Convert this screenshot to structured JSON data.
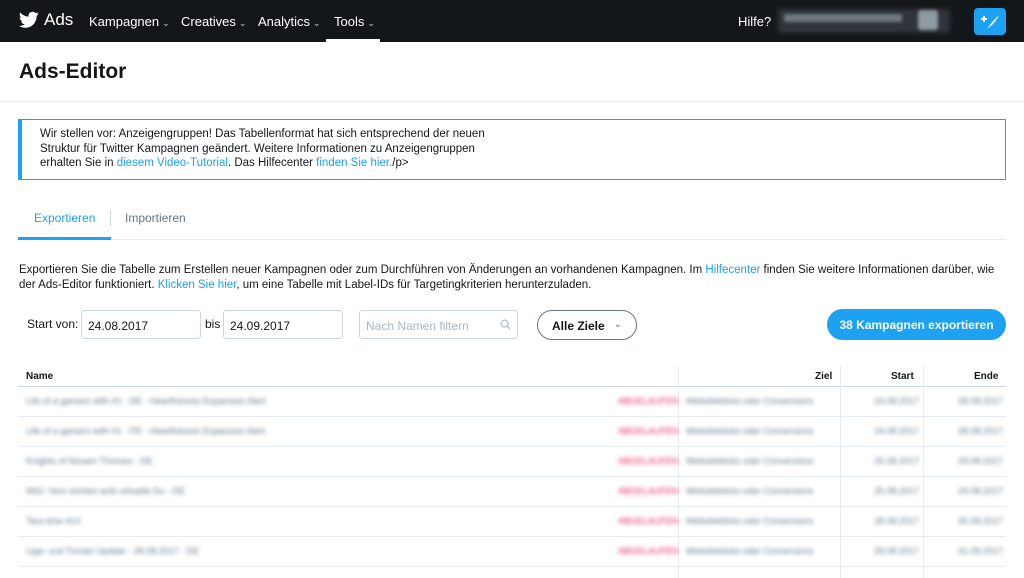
{
  "nav": {
    "brand": "Ads",
    "items": [
      "Kampagnen",
      "Creatives",
      "Analytics",
      "Tools"
    ],
    "help": "Hilfe?",
    "account": "UPC eSport Weeke"
  },
  "page_title": "Ads-Editor",
  "notice": {
    "line1": "Wir stellen vor: Anzeigengruppen! Das Tabellenformat hat sich entsprechend der neuen",
    "line2": "Struktur für Twitter Kampagnen geändert. Weitere Informationen zu Anzeigengruppen",
    "line3_pre": "erhalten Sie in ",
    "link1": "diesem Video-Tutorial",
    "line3_mid": ". Das Hilfecenter ",
    "link2": "finden Sie hier.",
    "line3_post": "/p>"
  },
  "tabs": {
    "export": "Exportieren",
    "import": "Importieren"
  },
  "intro": {
    "t1": "Exportieren Sie die Tabelle zum Erstellen neuer Kampagnen oder zum Durchführen von Änderungen an vorhandenen Kampagnen. Im ",
    "link1": "Hilfecenter",
    "t2": " finden Sie weitere Informationen darüber, wie der Ads-Editor funktioniert. ",
    "link2": "Klicken Sie hier",
    "t3": ", um eine Tabelle mit Label-IDs für Targetingkriterien herunterzuladen."
  },
  "filters": {
    "start_label": "Start von:",
    "start_value": "24.08.2017",
    "to_label": "bis",
    "end_value": "24.09.2017",
    "search_placeholder": "Nach Namen filtern",
    "goals": "Alle Ziele",
    "export_button": "38 Kampagnen exportieren"
  },
  "table": {
    "headers": {
      "name": "Name",
      "goal": "Ziel",
      "start": "Start",
      "end": "Ende"
    },
    "rows": [
      {
        "name": "Life of a gamers with #1 - DE - Heartfulness Expansion Alert",
        "status": "ABGELAUFEN",
        "goal": "Websiteklicks oder Conversions",
        "start": "24.08.2017",
        "end": "28.08.2017"
      },
      {
        "name": "Life of a gamers with #1 - FR - Heartfulness Expansion Alert",
        "status": "ABGELAUFEN",
        "goal": "Websiteklicks oder Conversions",
        "start": "24.08.2017",
        "end": "28.08.2017"
      },
      {
        "name": "Knights of Nosam Thrones - DE",
        "status": "ABGELAUFEN",
        "goal": "Websiteklicks oder Conversions",
        "start": "25.08.2017",
        "end": "29.08.2017"
      },
      {
        "name": "WiG: Vom sichten aufs virtuelle Du - DE",
        "status": "ABGELAUFEN",
        "goal": "Websiteklicks oder Conversions",
        "start": "25.08.2017",
        "end": "29.08.2017"
      },
      {
        "name": "Tara time #14",
        "status": "ABGELAUFEN",
        "goal": "Websiteklicks oder Conversions",
        "start": "28.08.2017",
        "end": "30.08.2017"
      },
      {
        "name": "Liga- und Turnier Update - 28.08.2017 - DE",
        "status": "ABGELAUFEN",
        "goal": "Websiteklicks oder Conversions",
        "start": "28.08.2017",
        "end": "01.09.2017"
      }
    ]
  },
  "colors": {
    "accent": "#1da1f2",
    "nav_bg": "#14171a",
    "warn": "#e0245e"
  }
}
